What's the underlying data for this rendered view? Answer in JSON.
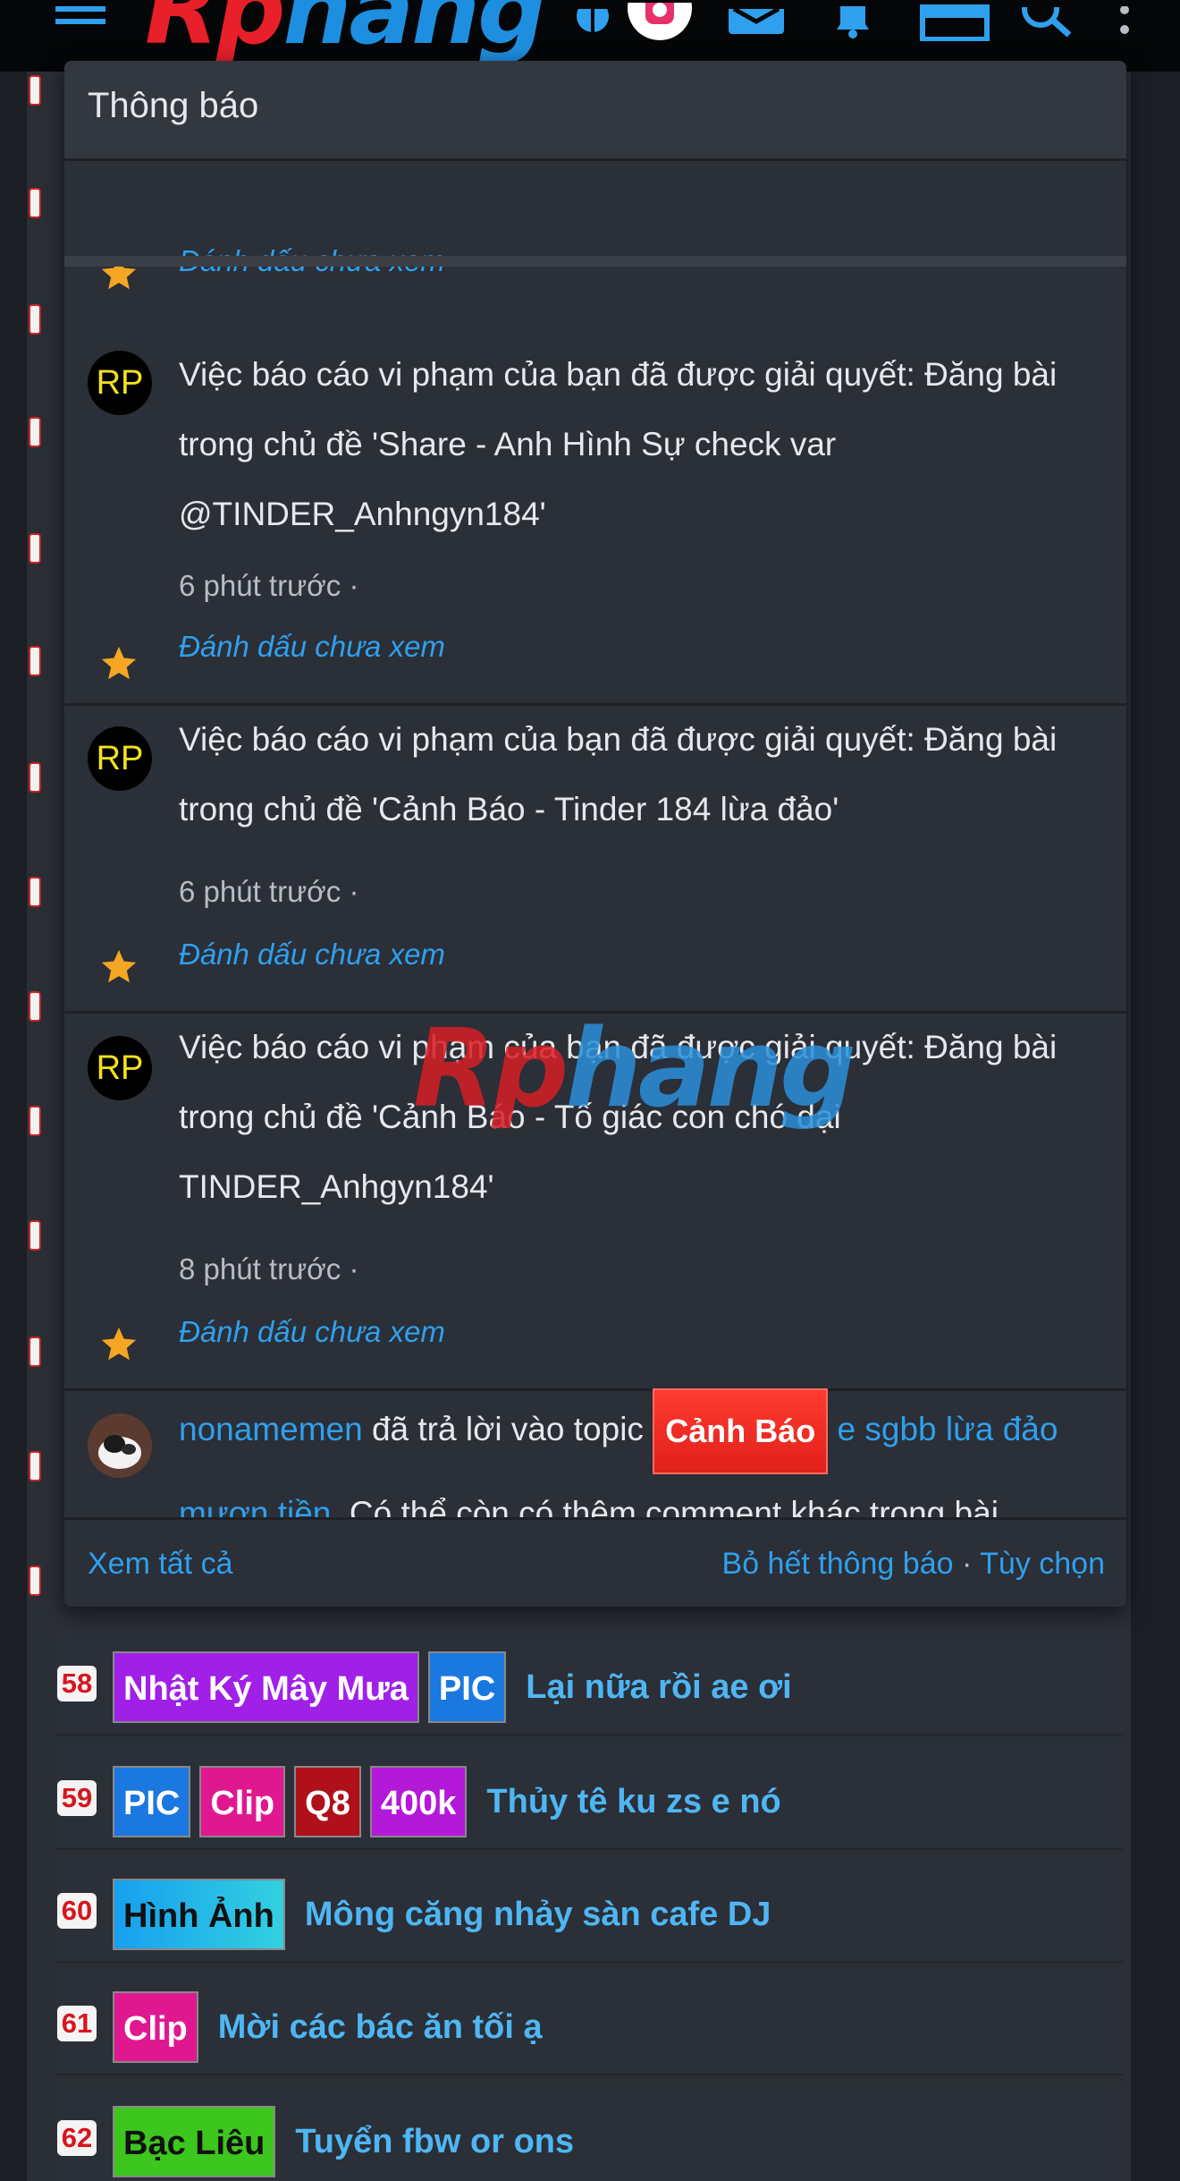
{
  "logo": {
    "part1": "Rp",
    "part2": "hang"
  },
  "topbar_icons": [
    "menu-icon",
    "dark-mode-icon",
    "instagram-icon",
    "inbox-icon",
    "bell-icon",
    "gift-icon",
    "search-icon",
    "more-vertical-icon"
  ],
  "popup": {
    "title": "Thông báo",
    "mark_unread": "Đánh dấu chưa xem",
    "notifications": [
      {
        "avatar": "RP",
        "text": "Việc báo cáo vi phạm của bạn đã được giải quyết: Đăng bài trong chủ đề 'Share - Anh Hình Sự check var @TINDER_Anhngyn184'",
        "time": "6 phút trước ·",
        "mark": "Đánh dấu chưa xem"
      },
      {
        "avatar": "RP",
        "text": "Việc báo cáo vi phạm của bạn đã được giải quyết: Đăng bài trong chủ đề 'Cảnh Báo - Tinder 184 lừa đảo'",
        "time": "6 phút trước ·",
        "mark": "Đánh dấu chưa xem"
      },
      {
        "avatar": "RP",
        "text": "Việc báo cáo vi phạm của bạn đã được giải quyết: Đăng bài trong chủ đề 'Cảnh Báo - Tố giác con chó dại TINDER_Anhgyn184'",
        "time": "8 phút trước ·",
        "mark": "Đánh dấu chưa xem"
      }
    ],
    "reply": {
      "user": "nonamemen",
      "action": " đã trả lời vào topic ",
      "tag": "Cảnh Báo",
      "topic": " e sgbb lừa đảo mượn tiền",
      "rest": ". Có thể còn có thêm comment khác trong bài"
    },
    "footer": {
      "view_all": "Xem tất cả",
      "dismiss_all": "Bỏ hết thông báo",
      "dot": " · ",
      "options": "Tùy chọn"
    }
  },
  "watermark": {
    "part1": "Rp",
    "part2": "hang"
  },
  "topics": [
    {
      "num": "58",
      "tags": [
        {
          "label": "Nhật Ký Mây Mưa",
          "color": "#a020e8"
        },
        {
          "label": "PIC",
          "color": "#1a78e0"
        }
      ],
      "title": "Lại nữa rồi ae ơi"
    },
    {
      "num": "59",
      "tags": [
        {
          "label": "PIC",
          "color": "#1a78e0"
        },
        {
          "label": "Clip",
          "color": "#e01890"
        },
        {
          "label": "Q8",
          "color": "#b0101a"
        },
        {
          "label": "400k",
          "color": "#b418d8"
        }
      ],
      "title": "Thủy tê ku zs e nó"
    },
    {
      "num": "60",
      "tags": [
        {
          "label": "Hình Ảnh",
          "color": "#22b2e6"
        }
      ],
      "title": "Mông căng nhảy sàn cafe DJ"
    },
    {
      "num": "61",
      "tags": [
        {
          "label": "Clip",
          "color": "#e01890"
        }
      ],
      "title": "Mời các bác ăn tối ạ"
    },
    {
      "num": "62",
      "tags": [
        {
          "label": "Bạc Liêu",
          "color": "#3cc61e"
        }
      ],
      "title": "Tuyển fbw or ons"
    }
  ]
}
